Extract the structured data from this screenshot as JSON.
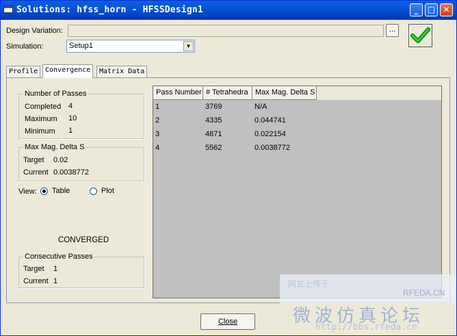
{
  "window": {
    "title": "Solutions: hfss_horn - HFSSDesign1",
    "minimize": "_",
    "maximize": "□",
    "close": "✕"
  },
  "design_variation": {
    "label": "Design Variation:",
    "value": "",
    "browse": "..."
  },
  "simulation": {
    "label": "Simulation:",
    "value": "Setup1"
  },
  "status_icon": "green-check-icon",
  "tabs": [
    {
      "label": "Profile",
      "active": false
    },
    {
      "label": "Convergence",
      "active": true
    },
    {
      "label": "Matrix Data",
      "active": false
    }
  ],
  "passes": {
    "title": "Number of Passes",
    "completed_label": "Completed",
    "completed": "4",
    "maximum_label": "Maximum",
    "maximum": "10",
    "minimum_label": "Minimum",
    "minimum": "1"
  },
  "delta": {
    "title": "Max Mag. Delta S",
    "target_label": "Target",
    "target": "0.02",
    "current_label": "Current",
    "current": "0.0038772"
  },
  "view": {
    "label": "View:",
    "table": "Table",
    "plot": "Plot",
    "selected": "Table"
  },
  "status": "CONVERGED",
  "consecutive": {
    "title": "Consecutive Passes",
    "target_label": "Target",
    "target": "1",
    "current_label": "Current",
    "current": "1"
  },
  "table": {
    "columns": [
      "Pass Number",
      "# Tetrahedra",
      "Max Mag. Delta S"
    ],
    "rows": [
      [
        "1",
        "3769",
        "N/A"
      ],
      [
        "2",
        "4335",
        "0.044741"
      ],
      [
        "3",
        "4871",
        "0.022154"
      ],
      [
        "4",
        "5562",
        "0.0038772"
      ]
    ]
  },
  "close_button": "Close",
  "watermark": {
    "line1": "网友上传于",
    "brand": "RFEDA.CN",
    "cn_name": "微波仿真论坛",
    "url": "http://bbs.rfeda.cn"
  }
}
